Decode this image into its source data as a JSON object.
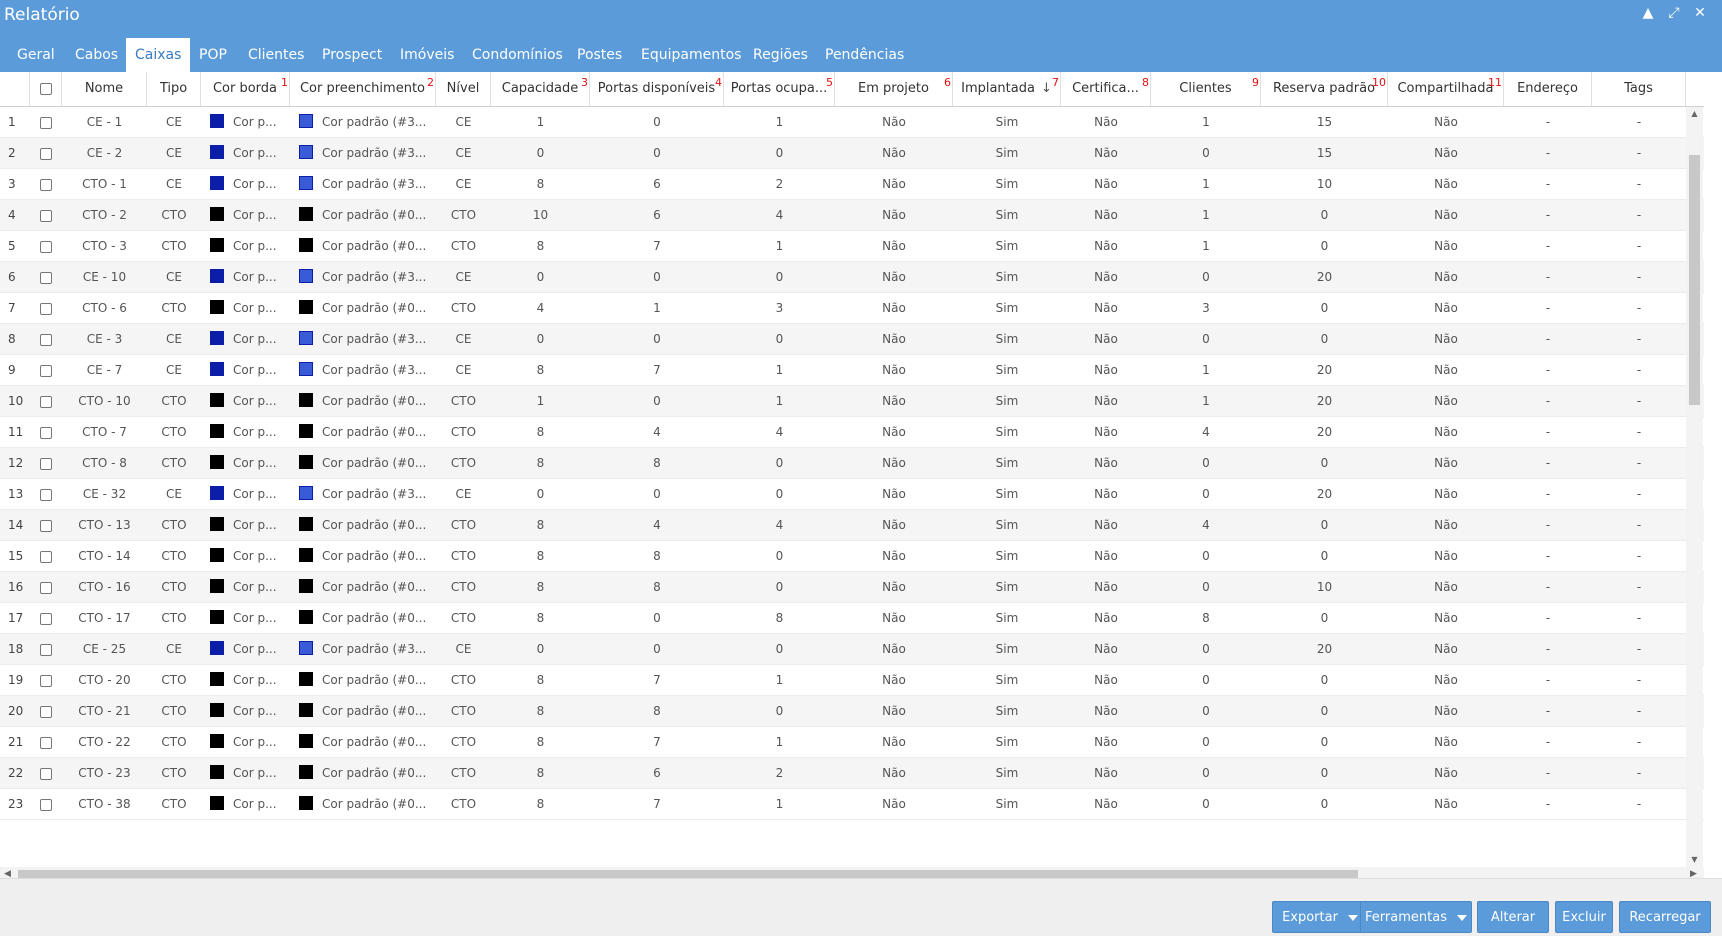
{
  "window": {
    "title": "Relatório",
    "controls": [
      "▲",
      "⤢",
      "✕"
    ]
  },
  "tabs": [
    {
      "label": "Geral"
    },
    {
      "label": "Cabos"
    },
    {
      "label": "Caixas",
      "active": true
    },
    {
      "label": "POP"
    },
    {
      "label": "Clientes"
    },
    {
      "label": "Prospect"
    },
    {
      "label": "Imóveis"
    },
    {
      "label": "Condomínios"
    },
    {
      "label": "Postes"
    },
    {
      "label": "Equipamentos"
    },
    {
      "label": "Regiões"
    },
    {
      "label": "Pendências"
    }
  ],
  "columns": [
    {
      "label": "Nome",
      "num": ""
    },
    {
      "label": "Tipo",
      "num": ""
    },
    {
      "label": "Cor borda",
      "num": "1"
    },
    {
      "label": "Cor preenchimento",
      "num": "2"
    },
    {
      "label": "Nível",
      "num": ""
    },
    {
      "label": "Capacidade",
      "num": "3"
    },
    {
      "label": "Portas disponíveis",
      "num": "4"
    },
    {
      "label": "Portas ocupa...",
      "num": "5"
    },
    {
      "label": "Em projeto",
      "num": "6"
    },
    {
      "label": "Implantada",
      "num": "7",
      "sort_icon": "↓"
    },
    {
      "label": "Certifica...",
      "num": "8"
    },
    {
      "label": "Clientes",
      "num": "9"
    },
    {
      "label": "Reserva padrão",
      "num": "10"
    },
    {
      "label": "Compartilhada",
      "num": "11"
    },
    {
      "label": "Endereço",
      "num": ""
    },
    {
      "label": "Tags",
      "num": ""
    }
  ],
  "colors": {
    "ce_border": "#0a1ea8",
    "ce_fill": "#3a5bd8",
    "cto": "#000000",
    "accent": "#5b9bd9"
  },
  "rows": [
    {
      "n": "1",
      "nome": "CE - 1",
      "tipo": "CE",
      "borda": "Cor p...",
      "preench": "Cor padrão (#3...",
      "nivel": "CE",
      "cap": "1",
      "disp": "0",
      "ocup": "1",
      "proj": "Não",
      "impl": "Sim",
      "cert": "Não",
      "cli": "1",
      "res": "15",
      "comp": "Não",
      "end": "-",
      "tags": "-"
    },
    {
      "n": "2",
      "nome": "CE - 2",
      "tipo": "CE",
      "borda": "Cor p...",
      "preench": "Cor padrão (#3...",
      "nivel": "CE",
      "cap": "0",
      "disp": "0",
      "ocup": "0",
      "proj": "Não",
      "impl": "Sim",
      "cert": "Não",
      "cli": "0",
      "res": "15",
      "comp": "Não",
      "end": "-",
      "tags": "-"
    },
    {
      "n": "3",
      "nome": "CTO - 1",
      "tipo": "CE",
      "borda": "Cor p...",
      "preench": "Cor padrão (#3...",
      "nivel": "CE",
      "cap": "8",
      "disp": "6",
      "ocup": "2",
      "proj": "Não",
      "impl": "Sim",
      "cert": "Não",
      "cli": "1",
      "res": "10",
      "comp": "Não",
      "end": "-",
      "tags": "-"
    },
    {
      "n": "4",
      "nome": "CTO - 2",
      "tipo": "CTO",
      "borda": "Cor p...",
      "preench": "Cor padrão (#0...",
      "nivel": "CTO",
      "cap": "10",
      "disp": "6",
      "ocup": "4",
      "proj": "Não",
      "impl": "Sim",
      "cert": "Não",
      "cli": "1",
      "res": "0",
      "comp": "Não",
      "end": "-",
      "tags": "-"
    },
    {
      "n": "5",
      "nome": "CTO - 3",
      "tipo": "CTO",
      "borda": "Cor p...",
      "preench": "Cor padrão (#0...",
      "nivel": "CTO",
      "cap": "8",
      "disp": "7",
      "ocup": "1",
      "proj": "Não",
      "impl": "Sim",
      "cert": "Não",
      "cli": "1",
      "res": "0",
      "comp": "Não",
      "end": "-",
      "tags": "-"
    },
    {
      "n": "6",
      "nome": "CE - 10",
      "tipo": "CE",
      "borda": "Cor p...",
      "preench": "Cor padrão (#3...",
      "nivel": "CE",
      "cap": "0",
      "disp": "0",
      "ocup": "0",
      "proj": "Não",
      "impl": "Sim",
      "cert": "Não",
      "cli": "0",
      "res": "20",
      "comp": "Não",
      "end": "-",
      "tags": "-"
    },
    {
      "n": "7",
      "nome": "CTO - 6",
      "tipo": "CTO",
      "borda": "Cor p...",
      "preench": "Cor padrão (#0...",
      "nivel": "CTO",
      "cap": "4",
      "disp": "1",
      "ocup": "3",
      "proj": "Não",
      "impl": "Sim",
      "cert": "Não",
      "cli": "3",
      "res": "0",
      "comp": "Não",
      "end": "-",
      "tags": "-"
    },
    {
      "n": "8",
      "nome": "CE - 3",
      "tipo": "CE",
      "borda": "Cor p...",
      "preench": "Cor padrão (#3...",
      "nivel": "CE",
      "cap": "0",
      "disp": "0",
      "ocup": "0",
      "proj": "Não",
      "impl": "Sim",
      "cert": "Não",
      "cli": "0",
      "res": "0",
      "comp": "Não",
      "end": "-",
      "tags": "-"
    },
    {
      "n": "9",
      "nome": "CE - 7",
      "tipo": "CE",
      "borda": "Cor p...",
      "preench": "Cor padrão (#3...",
      "nivel": "CE",
      "cap": "8",
      "disp": "7",
      "ocup": "1",
      "proj": "Não",
      "impl": "Sim",
      "cert": "Não",
      "cli": "1",
      "res": "20",
      "comp": "Não",
      "end": "-",
      "tags": "-"
    },
    {
      "n": "10",
      "nome": "CTO - 10",
      "tipo": "CTO",
      "borda": "Cor p...",
      "preench": "Cor padrão (#0...",
      "nivel": "CTO",
      "cap": "1",
      "disp": "0",
      "ocup": "1",
      "proj": "Não",
      "impl": "Sim",
      "cert": "Não",
      "cli": "1",
      "res": "20",
      "comp": "Não",
      "end": "-",
      "tags": "-"
    },
    {
      "n": "11",
      "nome": "CTO - 7",
      "tipo": "CTO",
      "borda": "Cor p...",
      "preench": "Cor padrão (#0...",
      "nivel": "CTO",
      "cap": "8",
      "disp": "4",
      "ocup": "4",
      "proj": "Não",
      "impl": "Sim",
      "cert": "Não",
      "cli": "4",
      "res": "20",
      "comp": "Não",
      "end": "-",
      "tags": "-"
    },
    {
      "n": "12",
      "nome": "CTO - 8",
      "tipo": "CTO",
      "borda": "Cor p...",
      "preench": "Cor padrão (#0...",
      "nivel": "CTO",
      "cap": "8",
      "disp": "8",
      "ocup": "0",
      "proj": "Não",
      "impl": "Sim",
      "cert": "Não",
      "cli": "0",
      "res": "0",
      "comp": "Não",
      "end": "-",
      "tags": "-"
    },
    {
      "n": "13",
      "nome": "CE - 32",
      "tipo": "CE",
      "borda": "Cor p...",
      "preench": "Cor padrão (#3...",
      "nivel": "CE",
      "cap": "0",
      "disp": "0",
      "ocup": "0",
      "proj": "Não",
      "impl": "Sim",
      "cert": "Não",
      "cli": "0",
      "res": "20",
      "comp": "Não",
      "end": "-",
      "tags": "-"
    },
    {
      "n": "14",
      "nome": "CTO - 13",
      "tipo": "CTO",
      "borda": "Cor p...",
      "preench": "Cor padrão (#0...",
      "nivel": "CTO",
      "cap": "8",
      "disp": "4",
      "ocup": "4",
      "proj": "Não",
      "impl": "Sim",
      "cert": "Não",
      "cli": "4",
      "res": "0",
      "comp": "Não",
      "end": "-",
      "tags": "-"
    },
    {
      "n": "15",
      "nome": "CTO - 14",
      "tipo": "CTO",
      "borda": "Cor p...",
      "preench": "Cor padrão (#0...",
      "nivel": "CTO",
      "cap": "8",
      "disp": "8",
      "ocup": "0",
      "proj": "Não",
      "impl": "Sim",
      "cert": "Não",
      "cli": "0",
      "res": "0",
      "comp": "Não",
      "end": "-",
      "tags": "-"
    },
    {
      "n": "16",
      "nome": "CTO - 16",
      "tipo": "CTO",
      "borda": "Cor p...",
      "preench": "Cor padrão (#0...",
      "nivel": "CTO",
      "cap": "8",
      "disp": "8",
      "ocup": "0",
      "proj": "Não",
      "impl": "Sim",
      "cert": "Não",
      "cli": "0",
      "res": "10",
      "comp": "Não",
      "end": "-",
      "tags": "-"
    },
    {
      "n": "17",
      "nome": "CTO - 17",
      "tipo": "CTO",
      "borda": "Cor p...",
      "preench": "Cor padrão (#0...",
      "nivel": "CTO",
      "cap": "8",
      "disp": "0",
      "ocup": "8",
      "proj": "Não",
      "impl": "Sim",
      "cert": "Não",
      "cli": "8",
      "res": "0",
      "comp": "Não",
      "end": "-",
      "tags": "-"
    },
    {
      "n": "18",
      "nome": "CE - 25",
      "tipo": "CE",
      "borda": "Cor p...",
      "preench": "Cor padrão (#3...",
      "nivel": "CE",
      "cap": "0",
      "disp": "0",
      "ocup": "0",
      "proj": "Não",
      "impl": "Sim",
      "cert": "Não",
      "cli": "0",
      "res": "20",
      "comp": "Não",
      "end": "-",
      "tags": "-"
    },
    {
      "n": "19",
      "nome": "CTO - 20",
      "tipo": "CTO",
      "borda": "Cor p...",
      "preench": "Cor padrão (#0...",
      "nivel": "CTO",
      "cap": "8",
      "disp": "7",
      "ocup": "1",
      "proj": "Não",
      "impl": "Sim",
      "cert": "Não",
      "cli": "0",
      "res": "0",
      "comp": "Não",
      "end": "-",
      "tags": "-"
    },
    {
      "n": "20",
      "nome": "CTO - 21",
      "tipo": "CTO",
      "borda": "Cor p...",
      "preench": "Cor padrão (#0...",
      "nivel": "CTO",
      "cap": "8",
      "disp": "8",
      "ocup": "0",
      "proj": "Não",
      "impl": "Sim",
      "cert": "Não",
      "cli": "0",
      "res": "0",
      "comp": "Não",
      "end": "-",
      "tags": "-"
    },
    {
      "n": "21",
      "nome": "CTO - 22",
      "tipo": "CTO",
      "borda": "Cor p...",
      "preench": "Cor padrão (#0...",
      "nivel": "CTO",
      "cap": "8",
      "disp": "7",
      "ocup": "1",
      "proj": "Não",
      "impl": "Sim",
      "cert": "Não",
      "cli": "0",
      "res": "0",
      "comp": "Não",
      "end": "-",
      "tags": "-"
    },
    {
      "n": "22",
      "nome": "CTO - 23",
      "tipo": "CTO",
      "borda": "Cor p...",
      "preench": "Cor padrão (#0...",
      "nivel": "CTO",
      "cap": "8",
      "disp": "6",
      "ocup": "2",
      "proj": "Não",
      "impl": "Sim",
      "cert": "Não",
      "cli": "0",
      "res": "0",
      "comp": "Não",
      "end": "-",
      "tags": "-"
    },
    {
      "n": "23",
      "nome": "CTO - 38",
      "tipo": "CTO",
      "borda": "Cor p...",
      "preench": "Cor padrão (#0...",
      "nivel": "CTO",
      "cap": "8",
      "disp": "7",
      "ocup": "1",
      "proj": "Não",
      "impl": "Sim",
      "cert": "Não",
      "cli": "0",
      "res": "0",
      "comp": "Não",
      "end": "-",
      "tags": "-"
    }
  ],
  "footer": {
    "buttons": [
      {
        "label": "Exportar",
        "dropdown": true
      },
      {
        "label": "Ferramentas",
        "dropdown": true
      },
      {
        "label": "Alterar",
        "dropdown": false
      },
      {
        "label": "Excluir",
        "dropdown": false
      },
      {
        "label": "Recarregar",
        "dropdown": false
      }
    ]
  }
}
